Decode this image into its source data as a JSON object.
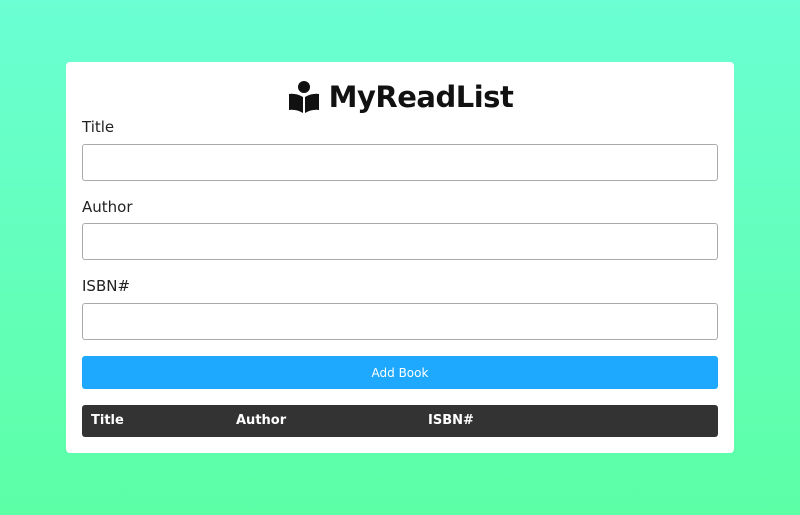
{
  "app": {
    "title": "MyReadList",
    "logo_icon": "book-reader-icon"
  },
  "form": {
    "title_label": "Title",
    "title_value": "",
    "author_label": "Author",
    "author_value": "",
    "isbn_label": "ISBN#",
    "isbn_value": "",
    "add_button_label": "Add Book"
  },
  "table": {
    "columns": [
      "Title",
      "Author",
      "ISBN#"
    ],
    "rows": []
  },
  "colors": {
    "background_top": "#6bffd3",
    "background_bottom": "#5cffa6",
    "button": "#1ea9ff",
    "table_header": "#333333"
  }
}
